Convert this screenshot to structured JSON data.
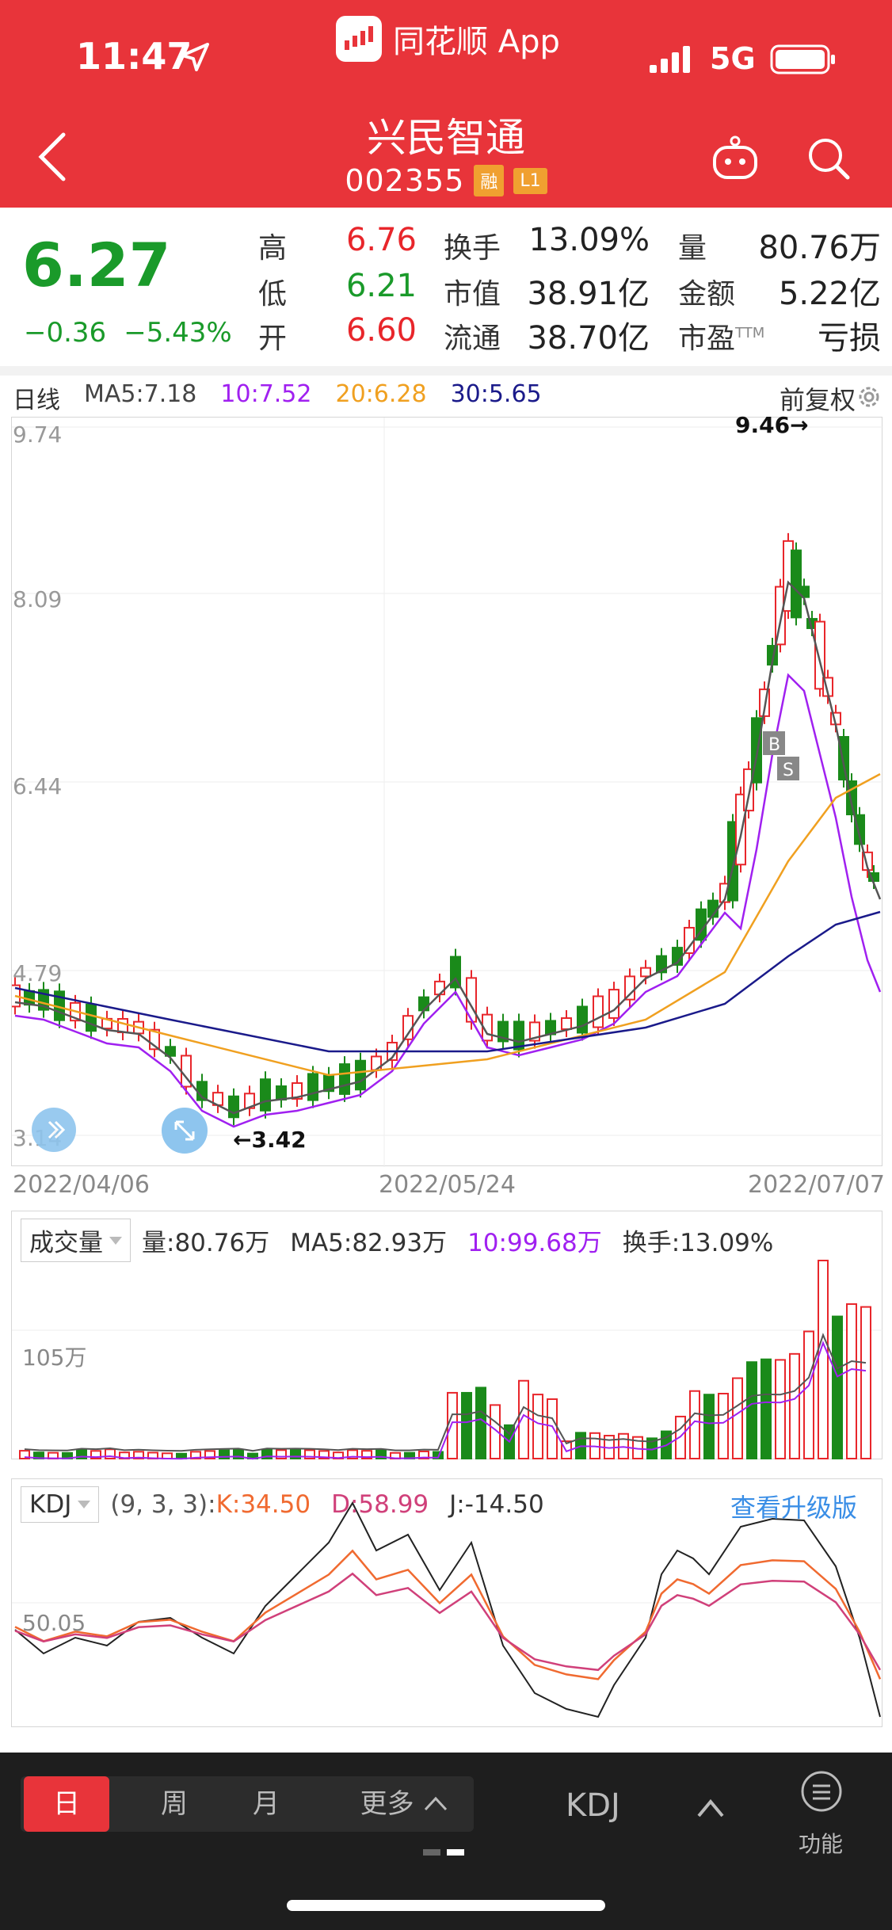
{
  "status": {
    "time": "11:47",
    "network": "5G"
  },
  "app": {
    "name": "同花顺 App"
  },
  "stock": {
    "name": "兴民智通",
    "code": "002355",
    "tags": [
      "融",
      "L1"
    ]
  },
  "quote": {
    "price": "6.27",
    "change": "−0.36",
    "change_pct": "−5.43%",
    "high_label": "高",
    "high": "6.76",
    "low_label": "低",
    "low": "6.21",
    "open_label": "开",
    "open": "6.60",
    "turnover_label": "换手",
    "turnover": "13.09%",
    "mcap_label": "市值",
    "mcap": "38.91亿",
    "float_label": "流通",
    "float": "38.70亿",
    "vol_label": "量",
    "vol": "80.76万",
    "amount_label": "金额",
    "amount": "5.22亿",
    "pe_label": "市盈",
    "pe_sup": "TTM",
    "pe": "亏损"
  },
  "colors": {
    "up": "#e8262b",
    "down": "#1a8a1a",
    "ma5": "#555555",
    "ma10": "#a020f0",
    "ma20": "#f0a020",
    "ma30": "#1a1a8a",
    "brand": "#e8343a"
  },
  "main_chart": {
    "period_label": "日线",
    "ma5": "MA5:7.18",
    "ma10": "10:7.52",
    "ma20": "20:6.28",
    "ma30": "30:5.65",
    "adjust": "前复权",
    "y_ticks": [
      "9.74",
      "8.09",
      "6.44",
      "4.79",
      "3.14"
    ],
    "dates": [
      "2022/04/06",
      "2022/05/24",
      "2022/07/07"
    ],
    "max_marker": "9.46→",
    "min_marker": "←3.42",
    "b_marker": "B",
    "s_marker": "S"
  },
  "volume": {
    "selector": "成交量",
    "vol": "量:80.76万",
    "ma5": "MA5:82.93万",
    "ma10": "10:99.68万",
    "turnover": "换手:13.09%",
    "tick": "105万"
  },
  "kdj": {
    "selector": "KDJ",
    "params": "(9, 3, 3):",
    "k": "K:34.50",
    "d": "D:58.99",
    "j": "J:-14.50",
    "upgrade": "查看升级版",
    "tick": "50.05"
  },
  "bottom_bar": {
    "periods": [
      "日",
      "周",
      "月",
      "更多"
    ],
    "indicator": "KDJ",
    "func": "功能"
  },
  "chart_data": {
    "type": "candlestick",
    "dates": [
      "2022/04/06",
      "2022/05/24",
      "2022/07/07"
    ],
    "ylim": [
      3.14,
      9.74
    ],
    "last_close": 6.27,
    "high_mark": 9.46,
    "low_mark": 3.42,
    "ma": {
      "ma5": 7.18,
      "ma10": 7.52,
      "ma20": 6.28,
      "ma30": 5.65
    }
  }
}
